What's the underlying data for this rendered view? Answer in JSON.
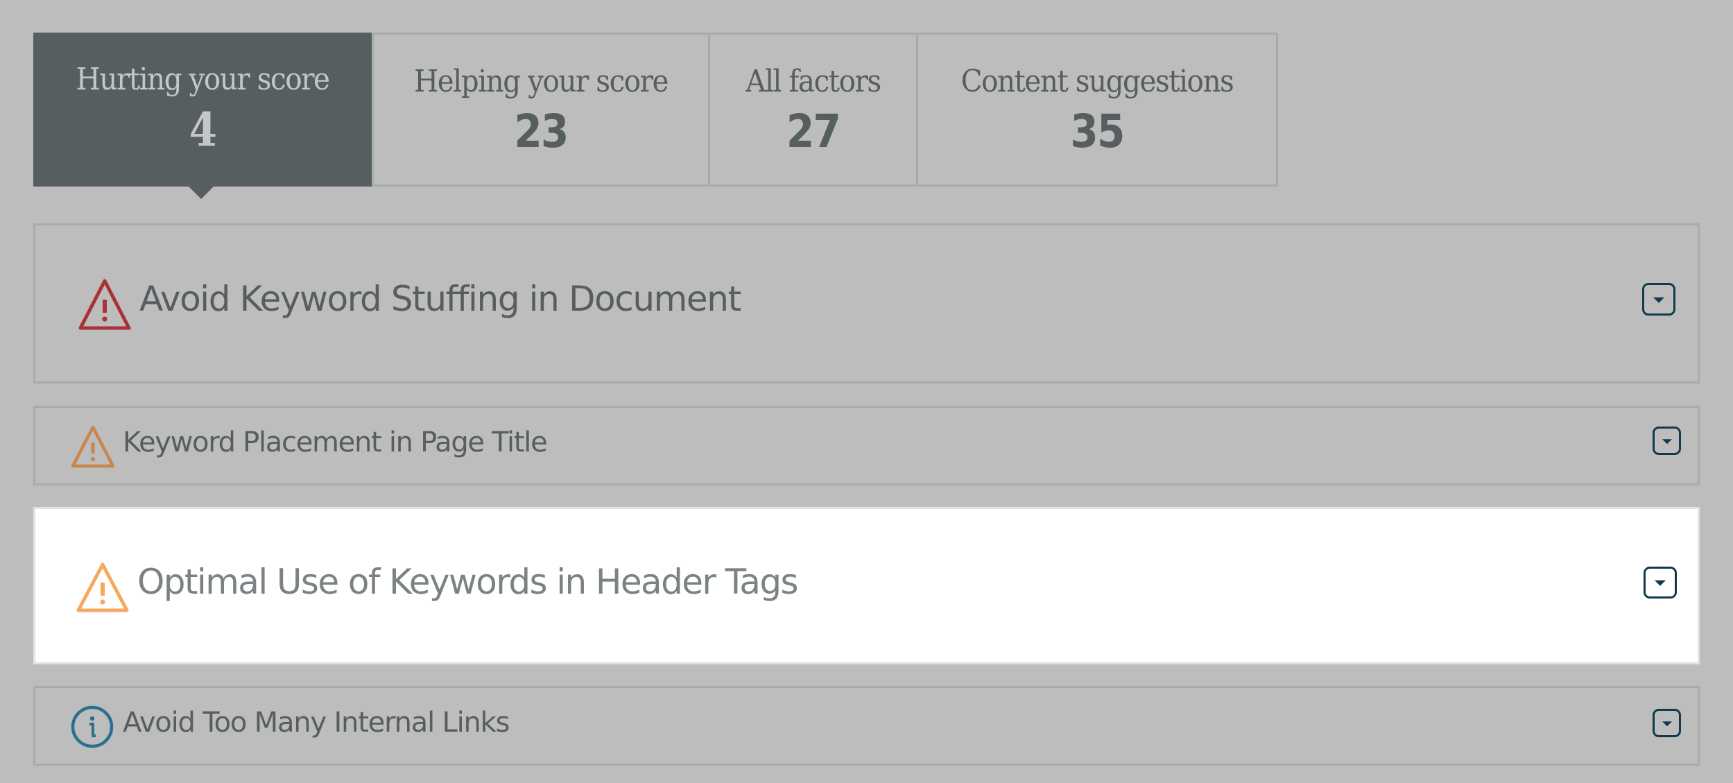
{
  "tabs": [
    {
      "label": "Hurting your score",
      "count": "4",
      "active": true
    },
    {
      "label": "Helping your score",
      "count": "23",
      "active": false
    },
    {
      "label": "All factors",
      "count": "27",
      "active": false
    },
    {
      "label": "Content suggestions",
      "count": "35",
      "active": false
    }
  ],
  "factors": [
    {
      "title": "Avoid Keyword Stuffing in Document",
      "severity": "critical",
      "icon": "warning-triangle-icon",
      "highlighted": false
    },
    {
      "title": "Keyword Placement in Page Title",
      "severity": "warning",
      "icon": "warning-triangle-icon",
      "highlighted": false
    },
    {
      "title": "Optimal Use of Keywords in Header Tags",
      "severity": "warning",
      "icon": "warning-triangle-icon",
      "highlighted": true
    },
    {
      "title": "Avoid Too Many Internal Links",
      "severity": "info",
      "icon": "info-circle-icon",
      "highlighted": false
    }
  ],
  "colors": {
    "background": "#bdbdbd",
    "active_tab": "#575e60",
    "text": "#575e60",
    "critical": "#a83236",
    "warning_dark": "#c8864a",
    "warning_light": "#f5a95c",
    "info": "#2a6f8f",
    "toggle": "#123a4c"
  },
  "toggle": {
    "aria_label": "Expand details"
  }
}
